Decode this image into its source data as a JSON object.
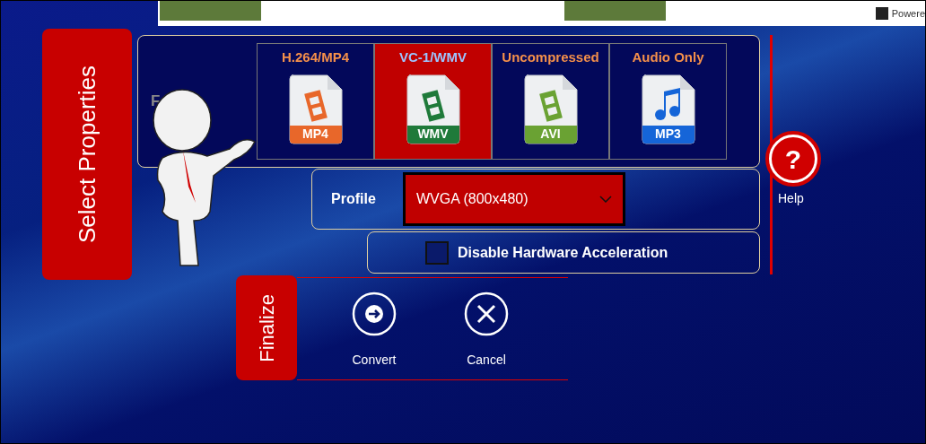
{
  "ad_bar": {
    "powered_text": "Powere"
  },
  "select_properties": {
    "title": "Select Properties",
    "format": {
      "label": "F",
      "options": [
        {
          "label": "H.264/MP4",
          "badge": "MP4",
          "color": "#e8672a",
          "kind": "video",
          "selected": false
        },
        {
          "label": "VC-1/WMV",
          "badge": "WMV",
          "color": "#1f7a3a",
          "kind": "video",
          "selected": true
        },
        {
          "label": "Uncompressed",
          "badge": "AVI",
          "color": "#6aa233",
          "kind": "video",
          "selected": false
        },
        {
          "label": "Audio Only",
          "badge": "MP3",
          "color": "#1565d8",
          "kind": "audio",
          "selected": false
        }
      ]
    },
    "profile": {
      "label": "Profile",
      "value": "WVGA (800x480)"
    },
    "hardware": {
      "label": "Disable Hardware Acceleration",
      "checked": false
    },
    "help": {
      "icon": "?",
      "label": "Help"
    }
  },
  "finalize": {
    "title": "Finalize",
    "buttons": [
      {
        "label": "Convert",
        "kind": "convert"
      },
      {
        "label": "Cancel",
        "kind": "cancel"
      }
    ]
  }
}
